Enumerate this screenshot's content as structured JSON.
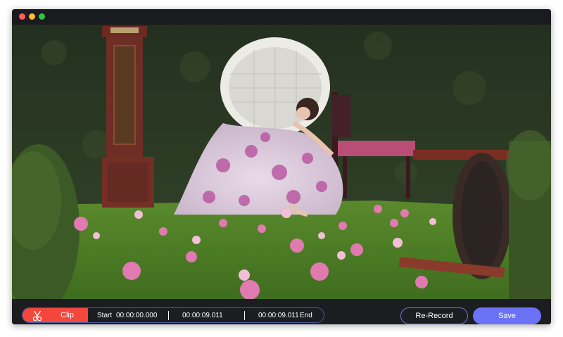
{
  "window": {
    "controls": [
      "close",
      "minimize",
      "maximize"
    ]
  },
  "icons": {
    "clip": "scissors-icon"
  },
  "toolbar": {
    "clip_label": "Clip",
    "start_label": "Start",
    "start_time": "00:00:00.000",
    "duration": "00:00:09.011",
    "end_time": "00:00:09.011",
    "end_label": "End",
    "rerecord_label": "Re-Record",
    "save_label": "Save"
  },
  "colors": {
    "clip_red": "#f3473d",
    "save_accent": "#6b72f5",
    "outline_blue": "#6a78d8"
  }
}
